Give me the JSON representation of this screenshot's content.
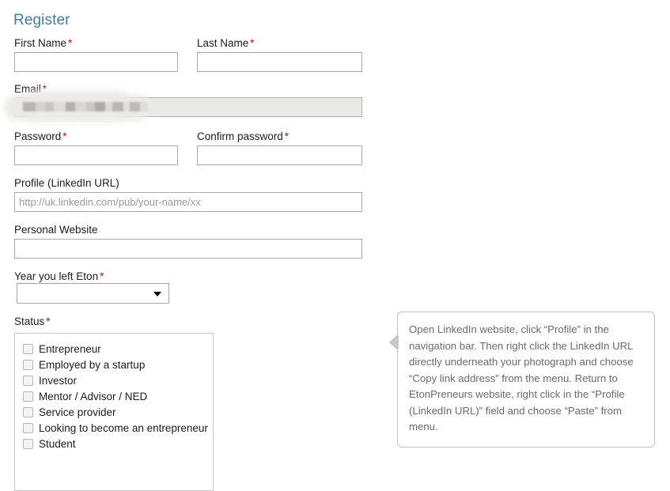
{
  "page": {
    "title": "Register"
  },
  "form": {
    "fields": {
      "first_name": {
        "label": "First Name",
        "required_mark": "*",
        "value": "",
        "placeholder": ""
      },
      "last_name": {
        "label": "Last Name",
        "required_mark": "*",
        "value": "",
        "placeholder": ""
      },
      "email": {
        "label": "Email",
        "required_mark": "*",
        "value": "",
        "placeholder": "",
        "redacted": "true"
      },
      "password": {
        "label": "Password",
        "required_mark": "*",
        "value": "",
        "placeholder": ""
      },
      "confirm_password": {
        "label": "Confirm password",
        "required_mark": "*",
        "value": "",
        "placeholder": ""
      },
      "profile_linkedin": {
        "label": "Profile (LinkedIn URL)",
        "required_mark": "",
        "value": "",
        "placeholder": "http://uk.linkedin.com/pub/your-name/xx"
      },
      "personal_website": {
        "label": "Personal Website",
        "required_mark": "",
        "value": "",
        "placeholder": ""
      },
      "year_left_eton": {
        "label": "Year you left Eton",
        "required_mark": "*",
        "selected": "",
        "options": [
          ""
        ]
      },
      "status": {
        "label": "Status",
        "required_mark": "*",
        "options": [
          {
            "label": "Entrepreneur",
            "checked": false
          },
          {
            "label": "Employed by a startup",
            "checked": false
          },
          {
            "label": "Investor",
            "checked": false
          },
          {
            "label": "Mentor / Advisor / NED",
            "checked": false
          },
          {
            "label": "Service provider",
            "checked": false
          },
          {
            "label": "Looking to become an entrepreneur",
            "checked": false
          },
          {
            "label": "Student",
            "checked": false
          }
        ]
      }
    }
  },
  "tooltip": {
    "text": "Open LinkedIn website, click “Profile” in the navigation bar. Then right click the LinkedIn URL directly underneath your photograph and choose “Copy link address” from the menu. Return to EtonPreneurs website, right click in the “Profile (LinkedIn URL)” field and choose “Paste” from menu."
  },
  "colors": {
    "heading": "#3d7ca8",
    "required": "#cc0011",
    "label_text": "#1c1c1c",
    "input_border": "#aaaaaa",
    "filled_input_bg": "#eaeae4",
    "tooltip_text": "#6a6a6a",
    "tooltip_border": "#c2c2c2",
    "placeholder": "#9a9a9a"
  }
}
